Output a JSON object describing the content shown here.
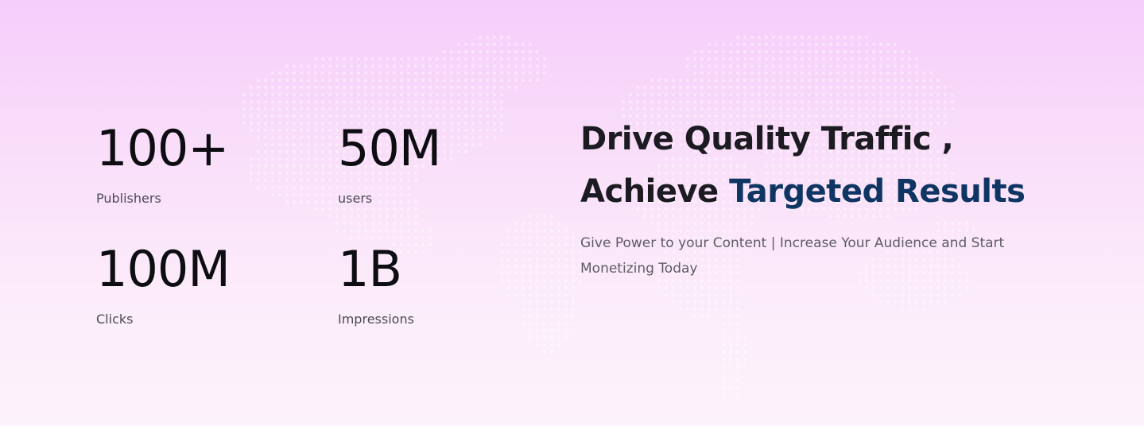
{
  "stats": [
    {
      "value": "100+",
      "label": "Publishers"
    },
    {
      "value": "50M",
      "label": "users"
    },
    {
      "value": "100M",
      "label": "Clicks"
    },
    {
      "value": "1B",
      "label": "Impressions"
    }
  ],
  "hero": {
    "headline_line1": "Drive Quality Traffic ,",
    "headline_line2_prefix": "Achieve",
    "headline_line2_accent": "Targeted Results",
    "subtext": "Give Power to your Content | Increase Your Audience and Start Monetizing Today"
  },
  "colors": {
    "accent": "#0f3563",
    "headline": "#1c1b21",
    "background_top": "#f6cdfb",
    "background_bottom": "#fdf3fb"
  },
  "background_graphic": "world-map-dots"
}
